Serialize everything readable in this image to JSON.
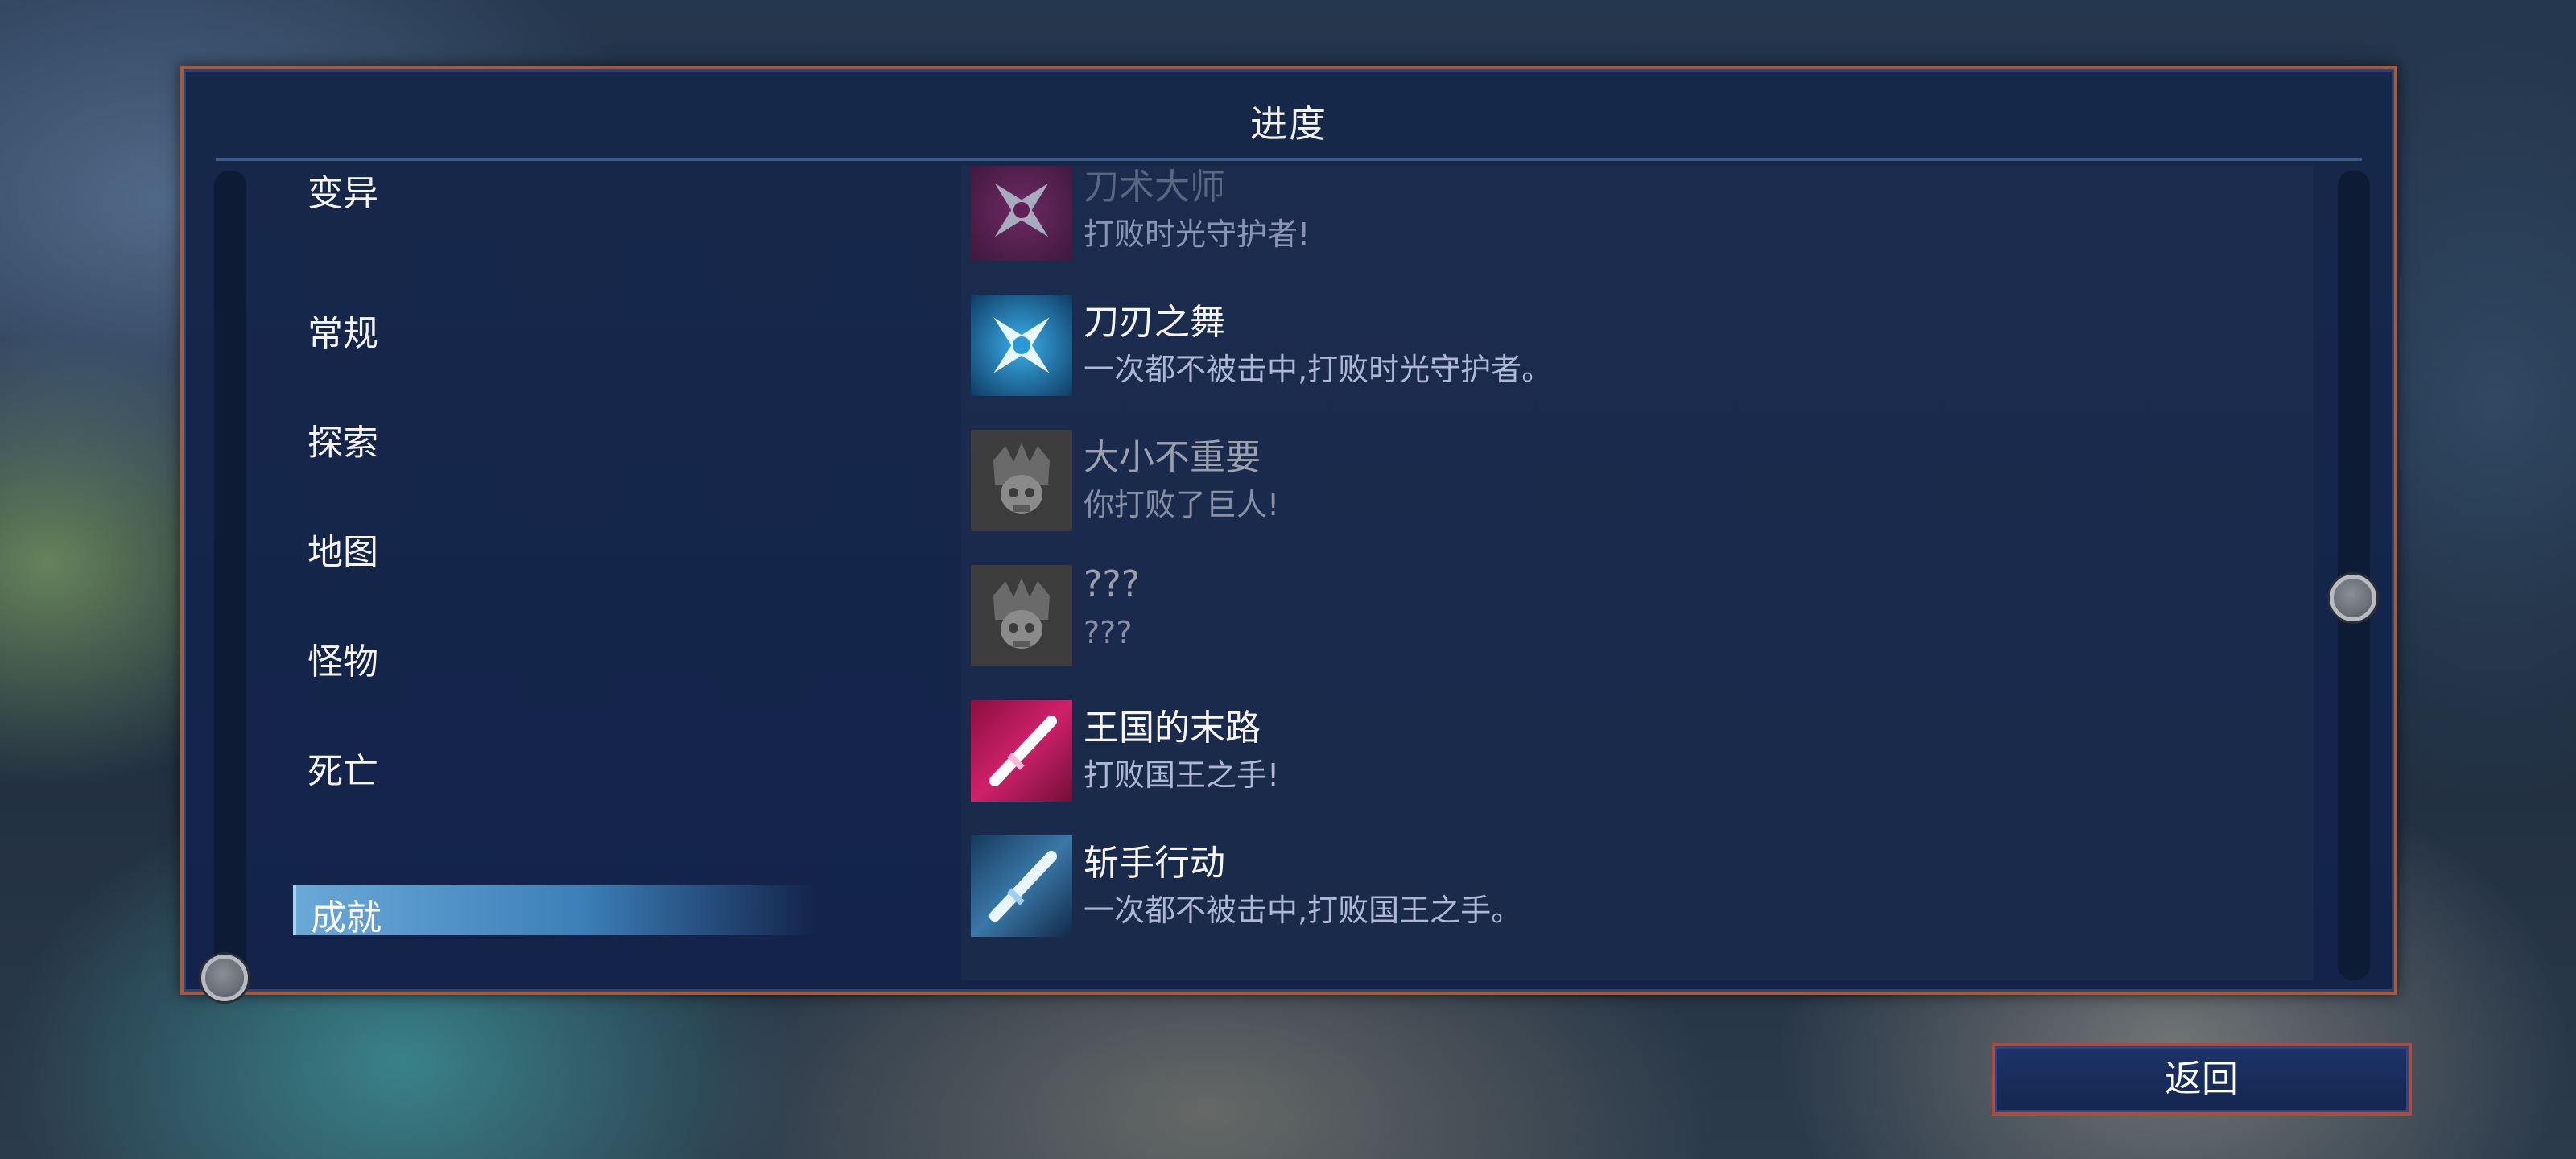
{
  "panel": {
    "title": "进度"
  },
  "categories": [
    "变异",
    "常规",
    "探索",
    "地图",
    "怪物",
    "死亡"
  ],
  "active_category": "成就",
  "achievements": [
    {
      "title": "刀术大师",
      "desc": "打败时光守护者!",
      "icon": "shuriken-pink-icon",
      "state": "faded"
    },
    {
      "title": "刀刃之舞",
      "desc": "一次都不被击中,打败时光守护者。",
      "icon": "shuriken-blue-icon",
      "state": "unlocked"
    },
    {
      "title": "大小不重要",
      "desc": "你打败了巨人!",
      "icon": "skull-crown-icon",
      "state": "locked"
    },
    {
      "title": "???",
      "desc": "???",
      "icon": "skull-crown-icon",
      "state": "locked"
    },
    {
      "title": "王国的末路",
      "desc": "打败国王之手!",
      "icon": "blade-pink-icon",
      "state": "unlocked"
    },
    {
      "title": "斩手行动",
      "desc": "一次都不被击中,打败国王之手。",
      "icon": "blade-blue-icon",
      "state": "unlocked"
    }
  ],
  "back_button": {
    "label": "返回"
  },
  "colors": {
    "panel_border": "#a65a3c",
    "panel_bg": "#16284a",
    "active_tab": "#6aa8d8"
  }
}
